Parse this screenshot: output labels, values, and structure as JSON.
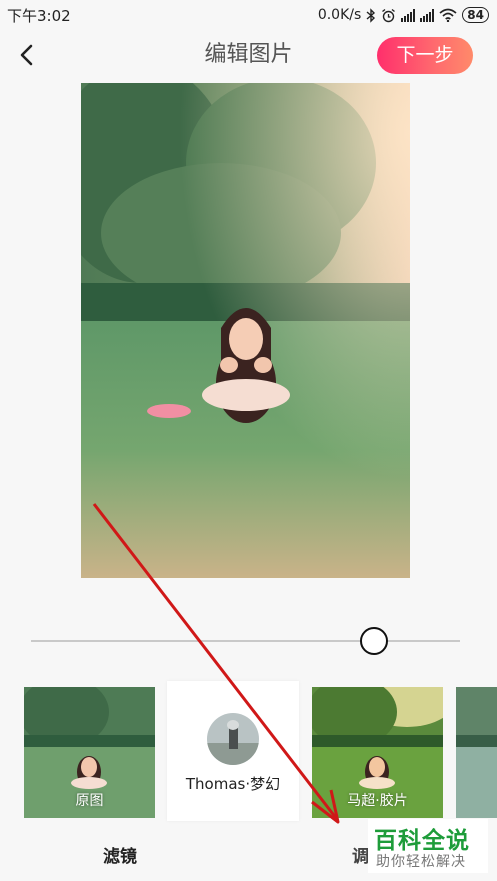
{
  "status_bar": {
    "time": "下午3:02",
    "network_speed": "0.0K/s",
    "battery": "84",
    "icons": [
      "bluetooth-icon",
      "alarm-icon",
      "signal-icon",
      "signal-icon",
      "wifi-icon",
      "battery-icon"
    ]
  },
  "header": {
    "back_icon": "chevron-left-icon",
    "title": "编辑图片",
    "next_label": "下一步",
    "next_color": "#ff4a6e"
  },
  "editor": {
    "intensity_level": 0.8
  },
  "filters": [
    {
      "label": "原图",
      "selected": false
    },
    {
      "label": "Thomas·梦幻",
      "selected": true
    },
    {
      "label": "马超·胶片",
      "selected": false
    },
    {
      "label": "",
      "selected": false
    }
  ],
  "bottom_tabs": {
    "filter_tab": "滤镜",
    "adjust_tab": "调"
  },
  "watermark": {
    "brand": "百科全说",
    "slogan": "助你轻松解决"
  },
  "colors": {
    "accent": "#ff4a6e",
    "watermark_green": "#1e9c3a",
    "annotation_arrow": "#d01818"
  }
}
